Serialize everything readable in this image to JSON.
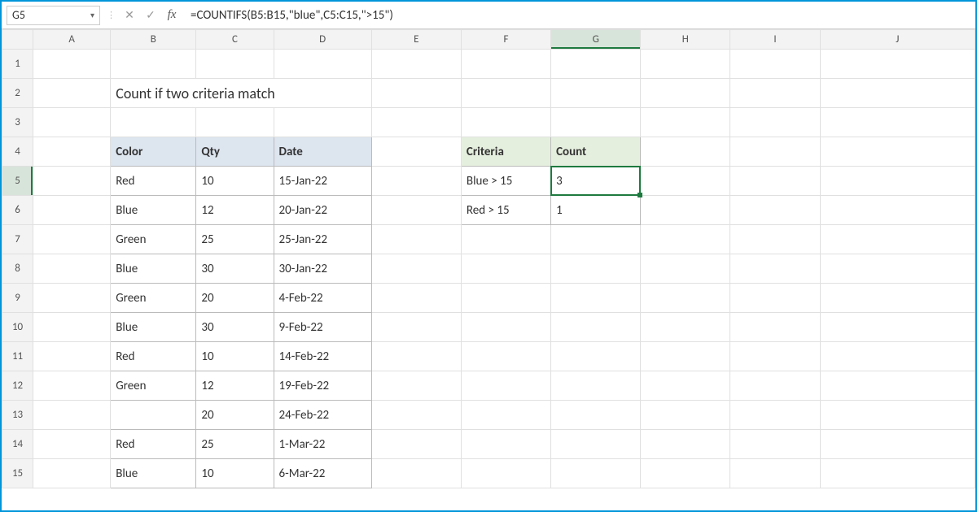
{
  "nameBox": "G5",
  "formula": "=COUNTIFS(B5:B15,\"blue\",C5:C15,\">15\")",
  "columns": [
    "A",
    "B",
    "C",
    "D",
    "E",
    "F",
    "G",
    "H",
    "I",
    "J"
  ],
  "rows": [
    "1",
    "2",
    "3",
    "4",
    "5",
    "6",
    "7",
    "8",
    "9",
    "10",
    "11",
    "12",
    "13",
    "14",
    "15"
  ],
  "title": "Count if two criteria match",
  "table1": {
    "headers": {
      "color": "Color",
      "qty": "Qty",
      "date": "Date"
    },
    "rows": [
      {
        "color": "Red",
        "qty": "10",
        "date": "15-Jan-22"
      },
      {
        "color": "Blue",
        "qty": "12",
        "date": "20-Jan-22"
      },
      {
        "color": "Green",
        "qty": "25",
        "date": "25-Jan-22"
      },
      {
        "color": "Blue",
        "qty": "30",
        "date": "30-Jan-22"
      },
      {
        "color": "Green",
        "qty": "20",
        "date": "4-Feb-22"
      },
      {
        "color": "Blue",
        "qty": "30",
        "date": "9-Feb-22"
      },
      {
        "color": "Red",
        "qty": "10",
        "date": "14-Feb-22"
      },
      {
        "color": "Green",
        "qty": "12",
        "date": "19-Feb-22"
      },
      {
        "color": "",
        "qty": "20",
        "date": "24-Feb-22"
      },
      {
        "color": "Red",
        "qty": "25",
        "date": "1-Mar-22"
      },
      {
        "color": "Blue",
        "qty": "10",
        "date": "6-Mar-22"
      }
    ]
  },
  "table2": {
    "headers": {
      "criteria": "Criteria",
      "count": "Count"
    },
    "rows": [
      {
        "criteria": "Blue > 15",
        "count": "3"
      },
      {
        "criteria": "Red > 15",
        "count": "1"
      }
    ]
  },
  "activeCell": "G5"
}
